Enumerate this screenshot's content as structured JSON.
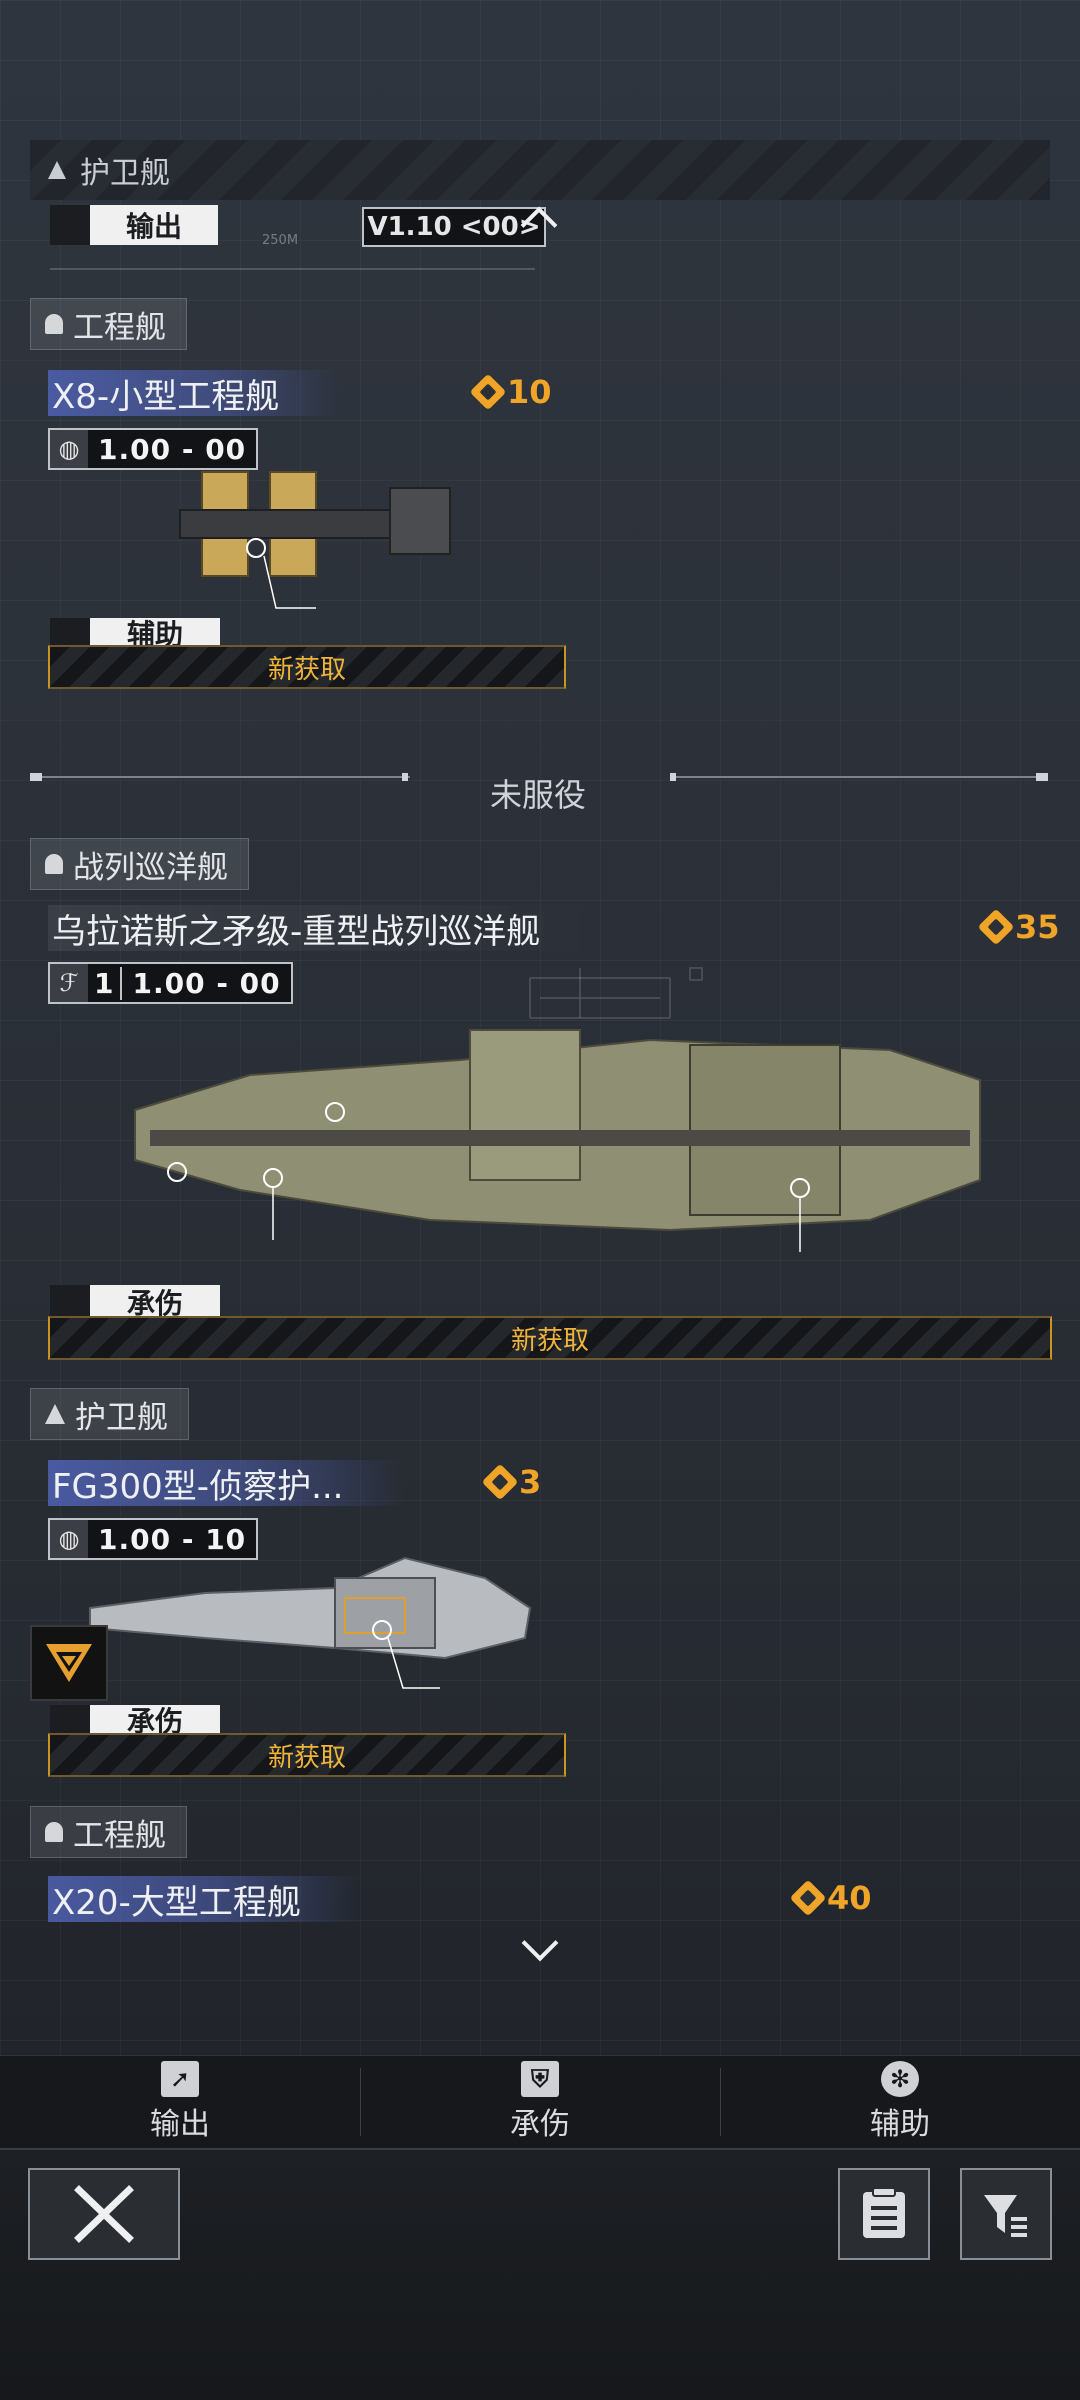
{
  "sticky_header": {
    "label": "护卫舰"
  },
  "partial_top": {
    "role_label": "输出",
    "version_label": "V1.10 <00>",
    "range_label": "250M"
  },
  "groups": [
    {
      "category": "工程舰",
      "ship": {
        "name": "X8-小型工程舰",
        "cost": "10",
        "stat": "1.00 - 00",
        "role": "辅助",
        "status": "新获取"
      }
    }
  ],
  "divider": {
    "label": "未服役"
  },
  "unserved": [
    {
      "category": "战列巡洋舰",
      "ship": {
        "name": "乌拉诺斯之矛级-重型战列巡洋舰",
        "cost": "35",
        "stat_prefix": "1",
        "stat": "1.00 - 00",
        "role": "承伤",
        "status": "新获取"
      }
    },
    {
      "category": "护卫舰",
      "ship": {
        "name": "FG300型-侦察护...",
        "cost": "3",
        "stat": "1.00 - 10",
        "role": "承伤",
        "status": "新获取"
      }
    },
    {
      "category": "工程舰",
      "ship": {
        "name": "X20-大型工程舰",
        "cost": "40"
      }
    }
  ],
  "tabs": [
    {
      "label": "输出",
      "icon": "output-arrow-icon"
    },
    {
      "label": "承伤",
      "icon": "shield-icon"
    },
    {
      "label": "辅助",
      "icon": "support-icon"
    }
  ],
  "colors": {
    "accent": "#f0a528",
    "name_highlight": "#5062b4",
    "bg": "#2b3038"
  }
}
